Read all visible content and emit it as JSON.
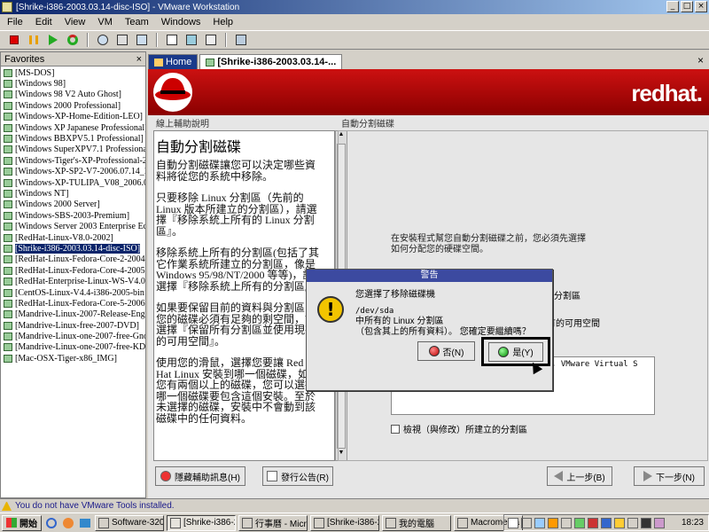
{
  "window": {
    "title": "[Shrike-i386-2003.03.14-disc-ISO] - VMware Workstation",
    "buttons": {
      "minimize": "_",
      "maximize": "□",
      "close": "×"
    }
  },
  "menu": [
    "File",
    "Edit",
    "View",
    "VM",
    "Team",
    "Windows",
    "Help"
  ],
  "toolbar": [
    "power-off-icon",
    "suspend-icon",
    "power-on-icon",
    "reset-icon",
    "snapshot-icon",
    "revert-snapshot-icon",
    "snapshot-manager-icon",
    "quick-switch-icon",
    "fullscreen-icon",
    "summary-view-icon",
    "console-view-icon"
  ],
  "favorites": {
    "title": "Favorites",
    "close": "×",
    "items": [
      "[MS-DOS]",
      "[Windows 98]",
      "[Windows 98 V2 Auto Ghost]",
      "[Windows 2000 Professional]",
      "[Windows-XP-Home-Edition-LEO]",
      "[Windows XP Japanese Professional]",
      "[Windows BBXPV5.1 Professional]",
      "[Windows SuperXPV7.1 Professional]",
      "[Windows-Tiger's-XP-Professional-20...",
      "[Windows-XP-SP2-V7-2006.07.14_IS...",
      "[Windows-XP-TULIPA_V08_2006.08...",
      "[Windows NT]",
      "[Windows 2000 Server]",
      "[Windows-SBS-2003-Premium]",
      "[Windows Server 2003 Enterprise Editi...",
      "[RedHat-Linux-V8.0-2002]",
      "[Shrike-i386-2003.03.14-disc-ISO]",
      "[RedHat-Linux-Fedora-Core-2-2004]",
      "[RedHat-Linux-Fedora-Core-4-2005]",
      "[RedHat-Enterprise-Linux-WS-V4.0-2...",
      "[CentOS-Linux-V4.4-i386-2005-bin1-...",
      "[RedHat-Linux-Fedora-Core-5-2006-i...",
      "[Mandrive-Linux-2007-Release-Eng-C...",
      "[Mandrive-Linux-free-2007-DVD]",
      "[Mandrive-Linux-one-2007-free-Gnom...",
      "[Mandrive-Linux-one-2007-free-KDE]",
      "[Mac-OSX-Tiger-x86_IMG]"
    ],
    "selected_index": 16
  },
  "tabs": {
    "home": "Home",
    "active": "[Shrike-i386-2003.03.14-...",
    "close": "×"
  },
  "guest": {
    "logo": "redhat.",
    "help_label": "線上輔助說明",
    "main_label": "自動分割磁碟",
    "help_title": "自動分割磁碟",
    "help_paragraphs": [
      "自動分割磁碟讓您可以決定哪些資料將從您的系統中移除。",
      "只要移除 Linux 分割區（先前的 Linux 版本所建立的分割區），請選擇『移除系統上所有的 Linux 分割區』。",
      "移除系統上所有的分割區(包括了其它作業系統所建立的分割區，像是 Windows 95/98/NT/2000 等等)，請選擇『移除系統上所有的分割區』。",
      "如果要保留目前的資料與分割區，您的磁碟必須有足夠的剩空間，請選擇『保留所有分割區並使用現有的可用空間』。",
      "使用您的滑鼠，選擇您要讓 Red Hat Linux 安裝到哪一個磁碟，如果您有兩個以上的磁碟，您可以選擇哪一個磁碟要包含這個安裝。至於未選擇的磁碟，安裝中不會動到該磁碟中的任何資料。"
    ],
    "intro": "在安裝程式幫您自動分割磁碟之前，您必須先選擇如何分配您的硬碟空間。",
    "option_partial_1": "分割區",
    "option_partial_2": "有的可用空間",
    "drive_item": ", VMware Virtual S",
    "review_label": "檢視（與修改）所建立的分割區",
    "buttons": {
      "hide_help": "隱藏輔助訊息(H)",
      "release_notes": "發行公告(R)",
      "back": "上一步(B)",
      "next": "下一步(N)"
    }
  },
  "dialog": {
    "title": "警告",
    "message": "您選擇了移除磁碟機",
    "device": "/dev/sda",
    "detail_line1": "中所有的 Linux 分割區",
    "detail_line2": "（包含其上的所有資料）。 您確定要繼續嗎？",
    "no": "否(N)",
    "yes": "是(Y)"
  },
  "status": {
    "message": "You do not have VMware Tools installed."
  },
  "taskbar": {
    "start": "開始",
    "tasks": [
      {
        "label": "Software-320G...",
        "icon": "folder-icon"
      },
      {
        "label": "[Shrike-i386-2...",
        "icon": "vmware-icon",
        "pressed": true
      },
      {
        "label": "行事曆 - Micr...",
        "icon": "calendar-icon"
      },
      {
        "label": "[Shrike-i386-2...",
        "icon": "folder-icon"
      },
      {
        "label": "我的電腦",
        "icon": "computer-icon"
      },
      {
        "label": "Macromedia Fi...",
        "icon": "fireworks-icon"
      }
    ],
    "clock": "18:23"
  },
  "colors": {
    "title_start": "#0a246a",
    "redhat_red": "#cc1111",
    "selected": "#0a246a",
    "status_text": "#1a1a8a"
  }
}
